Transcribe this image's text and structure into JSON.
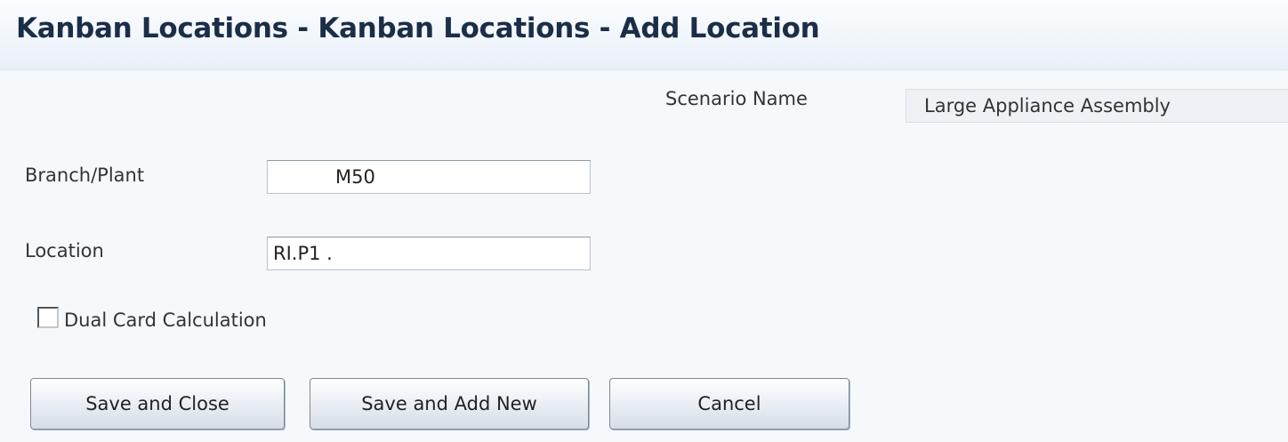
{
  "window": {
    "title": "Kanban Locations - Kanban Locations - Add Location"
  },
  "form": {
    "scenario_name": {
      "label": "Scenario Name",
      "value": "Large Appliance Assembly"
    },
    "branch_plant": {
      "label": "Branch/Plant",
      "value": "M50"
    },
    "location": {
      "label": "Location",
      "value": "RI.P1 ."
    },
    "dual_card": {
      "label": "Dual Card Calculation",
      "checked": false
    }
  },
  "buttons": {
    "save_close": "Save and Close",
    "save_add_new": "Save and Add New",
    "cancel": "Cancel"
  }
}
